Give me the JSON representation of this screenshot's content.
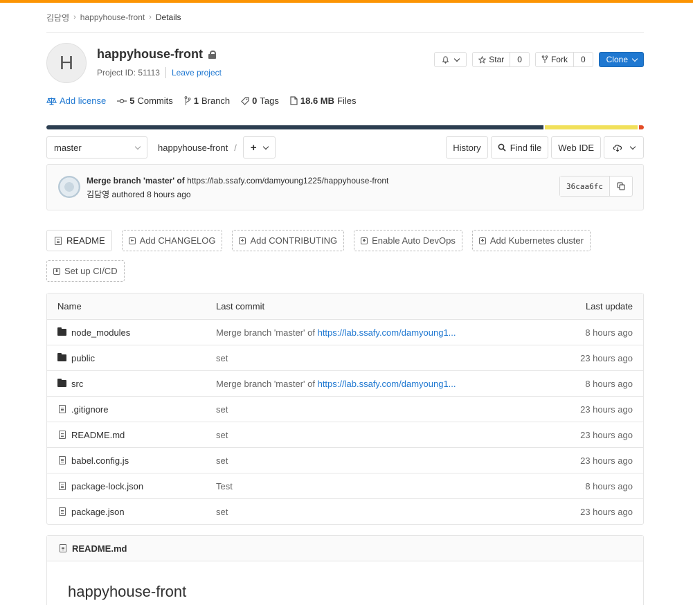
{
  "breadcrumb": {
    "namespace": "김담영",
    "project": "happyhouse-front",
    "current": "Details"
  },
  "project": {
    "avatar_letter": "H",
    "name": "happyhouse-front",
    "id_text": "Project ID: 51113",
    "leave_label": "Leave project"
  },
  "actions": {
    "star_label": "Star",
    "star_count": "0",
    "fork_label": "Fork",
    "fork_count": "0",
    "clone_label": "Clone"
  },
  "stats": {
    "add_license": "Add license",
    "commits_count": "5",
    "commits_label": "Commits",
    "branch_count": "1",
    "branch_label": "Branch",
    "tags_count": "0",
    "tags_label": "Tags",
    "files_size": "18.6 MB",
    "files_label": "Files"
  },
  "language_bar": [
    {
      "color": "#2c3e50",
      "percent": 83.2
    },
    {
      "color": "#f1e05a",
      "percent": 15.8
    },
    {
      "color": "#e34c26",
      "percent": 1.0
    }
  ],
  "toolbar": {
    "branch": "master",
    "path": "happyhouse-front",
    "path_sep": "/",
    "history": "History",
    "find_file": "Find file",
    "web_ide": "Web IDE"
  },
  "last_commit": {
    "title": "Merge branch 'master' of",
    "url": "https://lab.ssafy.com/damyoung1225/happyhouse-front",
    "author": "김담영",
    "authored": "authored 8 hours ago",
    "sha": "36caa6fc"
  },
  "quick_links": [
    {
      "label": "README",
      "solid": true
    },
    {
      "label": "Add CHANGELOG",
      "solid": false
    },
    {
      "label": "Add CONTRIBUTING",
      "solid": false
    },
    {
      "label": "Enable Auto DevOps",
      "solid": false
    },
    {
      "label": "Add Kubernetes cluster",
      "solid": false
    },
    {
      "label": "Set up CI/CD",
      "solid": false
    }
  ],
  "table": {
    "headers": {
      "name": "Name",
      "commit": "Last commit",
      "update": "Last update"
    },
    "rows": [
      {
        "type": "folder",
        "name": "node_modules",
        "commit": "Merge branch 'master' of ",
        "link": "https://lab.ssafy.com/damyoung1...",
        "update": "8 hours ago"
      },
      {
        "type": "folder",
        "name": "public",
        "commit": "set",
        "link": "",
        "update": "23 hours ago"
      },
      {
        "type": "folder",
        "name": "src",
        "commit": "Merge branch 'master' of ",
        "link": "https://lab.ssafy.com/damyoung1...",
        "update": "8 hours ago"
      },
      {
        "type": "file",
        "name": ".gitignore",
        "commit": "set",
        "link": "",
        "update": "23 hours ago"
      },
      {
        "type": "file",
        "name": "README.md",
        "commit": "set",
        "link": "",
        "update": "23 hours ago"
      },
      {
        "type": "file",
        "name": "babel.config.js",
        "commit": "set",
        "link": "",
        "update": "23 hours ago"
      },
      {
        "type": "file",
        "name": "package-lock.json",
        "commit": "Test",
        "link": "",
        "update": "8 hours ago"
      },
      {
        "type": "file",
        "name": "package.json",
        "commit": "set",
        "link": "",
        "update": "23 hours ago"
      }
    ]
  },
  "readme": {
    "filename": "README.md",
    "heading": "happyhouse-front"
  }
}
